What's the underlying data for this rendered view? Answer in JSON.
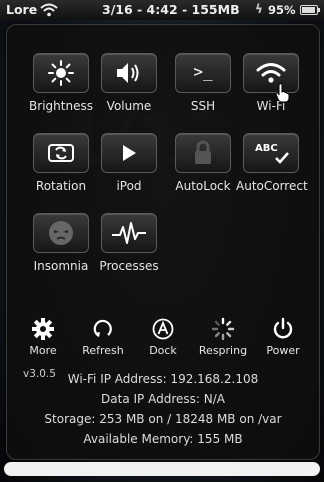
{
  "status_bar": {
    "carrier": "Lore",
    "datetime": "3/16 - 4:42 - 155MB",
    "battery_percent": "95%",
    "battery_level": 0.95
  },
  "tiles": [
    {
      "label": "Brightness",
      "icon": "brightness-icon"
    },
    {
      "label": "Volume",
      "icon": "volume-icon"
    },
    {
      "label": "SSH",
      "icon": "terminal-icon"
    },
    {
      "label": "Wi-Fi",
      "icon": "wifi-icon"
    },
    {
      "label": "Rotation",
      "icon": "rotation-icon"
    },
    {
      "label": "iPod",
      "icon": "play-icon"
    },
    {
      "label": "AutoLock",
      "icon": "lock-icon"
    },
    {
      "label": "AutoCorrect",
      "icon": "abc-check-icon"
    },
    {
      "label": "Insomnia",
      "icon": "insomnia-face-icon"
    },
    {
      "label": "Processes",
      "icon": "pulse-icon"
    }
  ],
  "bottom_actions": [
    {
      "label": "More",
      "icon": "gear-icon"
    },
    {
      "label": "Refresh",
      "icon": "refresh-icon"
    },
    {
      "label": "Dock",
      "icon": "dock-icon"
    },
    {
      "label": "Respring",
      "icon": "spinner-icon"
    },
    {
      "label": "Power",
      "icon": "power-icon"
    }
  ],
  "version": "v3.0.5",
  "info": {
    "wifi_ip": "Wi-Fi IP Address: 192.168.2.108",
    "data_ip": "Data IP Address: N/A",
    "storage": "Storage: 253 MB on / 18248 MB on /var",
    "memory": "Available Memory: 155 MB"
  },
  "abc_text": "ABC",
  "ssh_glyph": ">_"
}
